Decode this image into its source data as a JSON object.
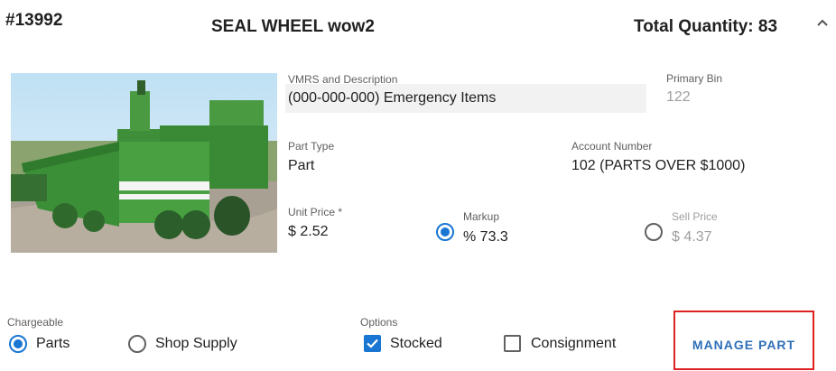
{
  "header": {
    "part_number": "#13992",
    "part_name": "SEAL WHEEL wow2",
    "total_quantity": "Total Quantity: 83"
  },
  "fields": {
    "vmrs_label": "VMRS and Description",
    "vmrs_value": "(000-000-000) Emergency Items",
    "primary_bin_label": "Primary Bin",
    "primary_bin_value": "122",
    "part_type_label": "Part Type",
    "part_type_value": "Part",
    "account_number_label": "Account Number",
    "account_number_value": "102 (PARTS OVER $1000)",
    "unit_price_label": "Unit Price *",
    "unit_price_value": "$ 2.52",
    "markup_label": "Markup",
    "markup_value": "% 73.3",
    "sell_price_label": "Sell Price",
    "sell_price_value": "$ 4.37"
  },
  "pricing_mode": {
    "selected": "Markup"
  },
  "chargeable": {
    "label": "Chargeable",
    "options": [
      "Parts",
      "Shop Supply"
    ],
    "selected": "Parts"
  },
  "options": {
    "label": "Options",
    "stocked_label": "Stocked",
    "stocked_checked": true,
    "consignment_label": "Consignment",
    "consignment_checked": false
  },
  "actions": {
    "manage_part_label": "MANAGE PART"
  },
  "colors": {
    "accent": "#1976d2",
    "highlight_border": "#e02020",
    "vehicle_green": "#3f9a3a"
  },
  "icons": {
    "collapse": "chevron-up-icon"
  }
}
